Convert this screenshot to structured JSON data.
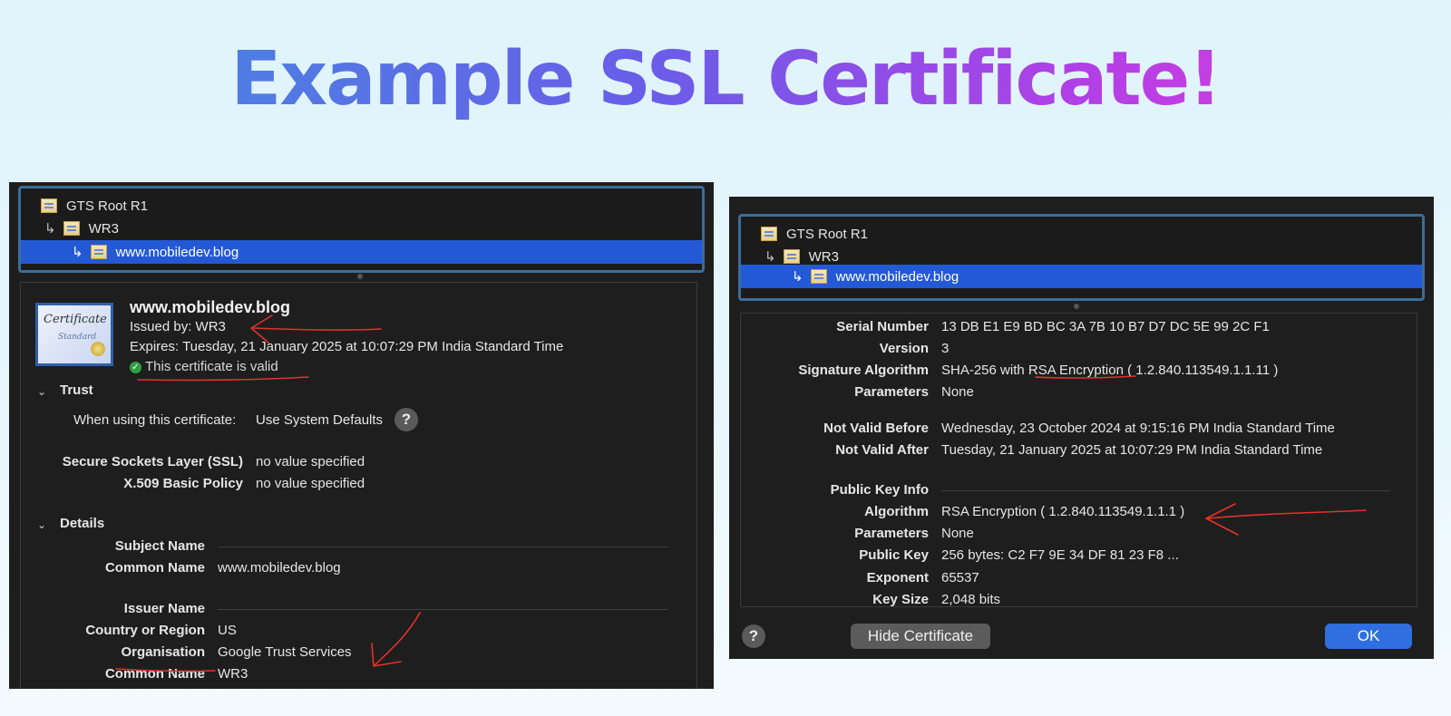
{
  "slide": {
    "title": "Example SSL Certificate!"
  },
  "chain": {
    "root": "GTS Root R1",
    "intermediate": "WR3",
    "leaf": "www.mobiledev.blog"
  },
  "left": {
    "cert_name": "www.mobiledev.blog",
    "issued_by": "Issued by: WR3",
    "expires": "Expires: Tuesday, 21 January 2025 at 10:07:29 PM India Standard Time",
    "valid_text": "This certificate is valid",
    "trust": {
      "header": "Trust",
      "using_label": "When using this certificate:",
      "using_value": "Use System Defaults",
      "ssl_label": "Secure Sockets Layer (SSL)",
      "ssl_value": "no value specified",
      "x509_label": "X.509 Basic Policy",
      "x509_value": "no value specified"
    },
    "details": {
      "header": "Details",
      "subject_name": "Subject Name",
      "common_name_label": "Common Name",
      "common_name_value": "www.mobiledev.blog",
      "issuer_name": "Issuer Name",
      "country_label": "Country or Region",
      "country_value": "US",
      "org_label": "Organisation",
      "org_value": "Google Trust Services",
      "issuer_cn_label": "Common Name",
      "issuer_cn_value": "WR3"
    }
  },
  "right": {
    "serial_label": "Serial Number",
    "serial_value": "13 DB E1 E9 BD BC 3A 7B 10 B7 D7 DC 5E 99 2C F1",
    "version_label": "Version",
    "version_value": "3",
    "sigalg_label": "Signature Algorithm",
    "sigalg_value": "SHA-256 with RSA Encryption ( 1.2.840.113549.1.1.11 )",
    "params_label": "Parameters",
    "params_value": "None",
    "nvb_label": "Not Valid Before",
    "nvb_value": "Wednesday, 23 October 2024 at 9:15:16 PM India Standard Time",
    "nva_label": "Not Valid After",
    "nva_value": "Tuesday, 21 January 2025 at 10:07:29 PM India Standard Time",
    "pki_label": "Public Key Info",
    "alg_label": "Algorithm",
    "alg_value": "RSA Encryption ( 1.2.840.113549.1.1.1 )",
    "params2_label": "Parameters",
    "params2_value": "None",
    "pubkey_label": "Public Key",
    "pubkey_value": "256 bytes: C2 F7 9E 34 DF 81 23 F8 ...",
    "exponent_label": "Exponent",
    "exponent_value": "65537",
    "keysize_label": "Key Size",
    "keysize_value": "2,048 bits",
    "help_label": "?",
    "hide_button": "Hide Certificate",
    "ok_button": "OK"
  },
  "icons": {
    "cert": "certificate-icon",
    "tree": "tree-branch-icon",
    "check": "checkmark-icon",
    "chevron": "chevron-down-icon",
    "help": "help-icon"
  },
  "colors": {
    "selection": "#2459d6",
    "ok_button": "#2f6fe0",
    "annotation": "#e2332b"
  }
}
